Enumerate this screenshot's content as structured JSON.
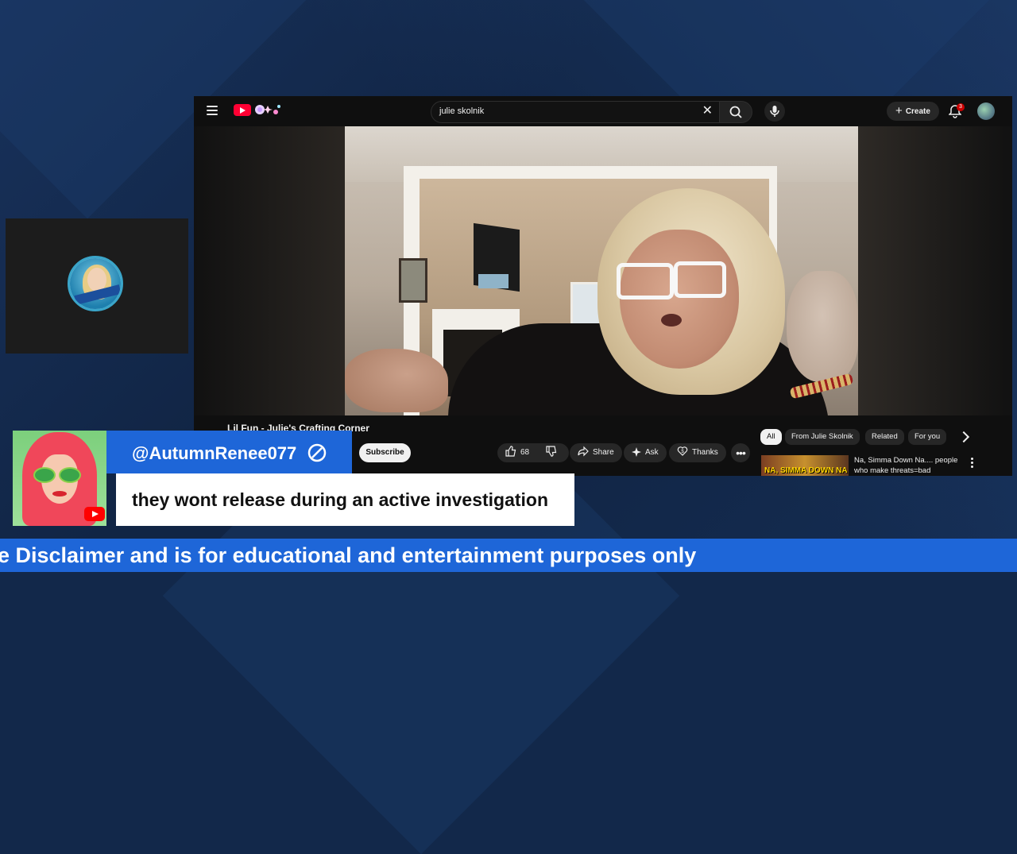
{
  "browser": {
    "search": {
      "value": "julie skolnik"
    },
    "create_label": "Create",
    "notification_count": "3"
  },
  "video": {
    "title": "Lil Fun - Julie's Crafting Corner",
    "subscribe_label": "Subscribe",
    "like_count": "68",
    "share_label": "Share",
    "ask_label": "Ask",
    "thanks_label": "Thanks"
  },
  "sidebar": {
    "chips": [
      {
        "label": "All",
        "active": true
      },
      {
        "label": "From Julie Skolnik"
      },
      {
        "label": "Related"
      },
      {
        "label": "For you"
      }
    ],
    "recommendation": {
      "title": "Na, Simma Down Na.... people who make threats=bad",
      "thumbnail_text": "NA, SIMMA DOWN NA"
    }
  },
  "chat": {
    "username": "@AutumnRenee077",
    "message": "they wont release during an active investigation"
  },
  "ticker": {
    "text": "e Disclaimer and is for educational and entertainment purposes only"
  },
  "colors": {
    "overlay_blue": "#1e66d8",
    "background": "#112545",
    "yt_red": "#ff0033"
  }
}
